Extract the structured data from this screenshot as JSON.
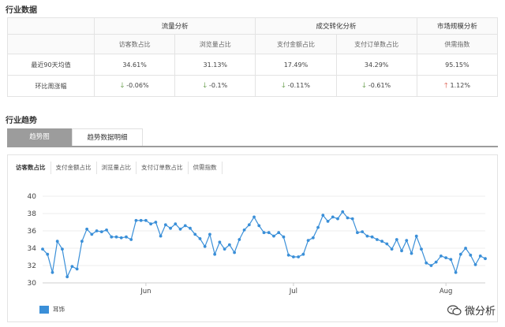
{
  "industry_data": {
    "title": "行业数据",
    "groups": [
      "流量分析",
      "成交转化分析",
      "市场规模分析"
    ],
    "columns": [
      "访客数占比",
      "浏览量占比",
      "支付金额占比",
      "支付订单数占比",
      "供需指数"
    ],
    "rows": [
      {
        "label": "最近90天均值",
        "values": [
          "34.61%",
          "31.13%",
          "17.49%",
          "34.29%",
          "95.15%"
        ]
      },
      {
        "label": "环比周涨幅",
        "values": [
          "-0.06%",
          "-0.1%",
          "-0.11%",
          "-0.61%",
          "1.12%"
        ],
        "directions": [
          "down",
          "down",
          "down",
          "down",
          "up"
        ]
      }
    ]
  },
  "industry_trend": {
    "title": "行业趋势",
    "tabs": [
      "趋势图",
      "趋势数据明细"
    ],
    "subtabs": [
      "访客数占比",
      "支付金额占比",
      "浏览量占比",
      "支付订单数占比",
      "供需指数"
    ],
    "legend_label": "耳饰"
  },
  "watermark": {
    "text": "微分析"
  },
  "colors": {
    "series": "#3a8fd8",
    "up": "#d94a3a",
    "down": "#4a8a2a"
  },
  "chart_data": {
    "type": "line",
    "title": "",
    "xlabel": "",
    "ylabel": "",
    "ylim": [
      30,
      40
    ],
    "yticks": [
      30,
      32,
      34,
      36,
      38,
      40
    ],
    "x_tick_labels": [
      {
        "index": 21,
        "label": "Jun"
      },
      {
        "index": 51,
        "label": "Jul"
      },
      {
        "index": 82,
        "label": "Aug"
      }
    ],
    "grid": true,
    "legend": "bottom-left",
    "series": [
      {
        "name": "耳饰",
        "values": [
          33.9,
          33.3,
          31.2,
          34.8,
          33.9,
          30.7,
          31.9,
          31.6,
          34.8,
          36.2,
          35.6,
          36.0,
          35.9,
          36.1,
          35.3,
          35.3,
          35.2,
          35.3,
          35.0,
          37.2,
          37.2,
          37.2,
          36.8,
          37.0,
          35.4,
          36.7,
          36.3,
          36.8,
          36.2,
          36.6,
          36.3,
          35.6,
          35.1,
          34.2,
          35.6,
          33.3,
          34.7,
          33.9,
          34.4,
          33.5,
          35.0,
          36.1,
          36.7,
          37.6,
          36.6,
          35.8,
          35.8,
          35.4,
          35.8,
          35.3,
          33.2,
          33.0,
          33.0,
          33.3,
          34.9,
          35.2,
          36.4,
          37.8,
          37.1,
          37.6,
          37.4,
          38.2,
          37.5,
          37.4,
          35.8,
          35.9,
          35.4,
          35.3,
          35.0,
          34.8,
          34.5,
          33.9,
          35.0,
          33.7,
          34.9,
          33.4,
          35.4,
          33.9,
          32.3,
          32.0,
          32.4,
          33.1,
          32.9,
          32.7,
          31.2,
          33.3,
          34.0,
          33.2,
          32.1,
          33.1,
          32.8
        ]
      }
    ]
  }
}
